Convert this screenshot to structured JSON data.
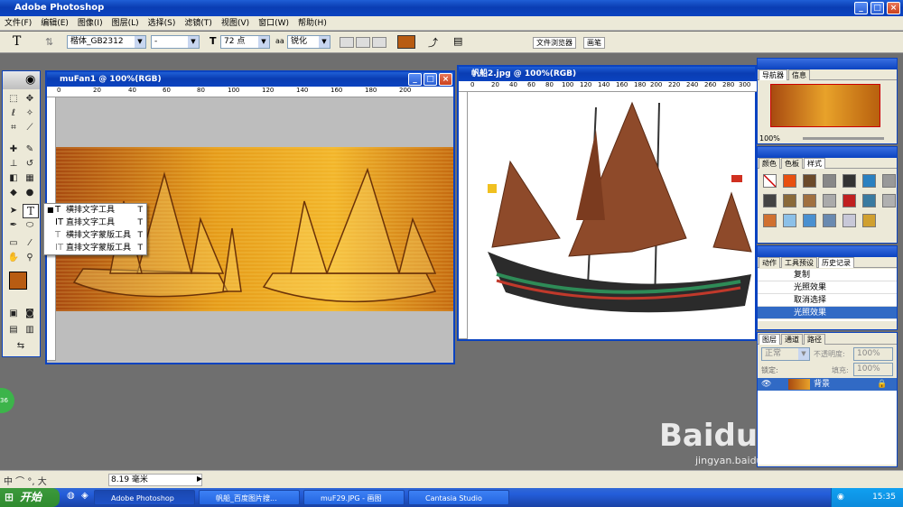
{
  "app": {
    "title": "Adobe Photoshop"
  },
  "menu": [
    "文件(F)",
    "编辑(E)",
    "图像(I)",
    "图层(L)",
    "选择(S)",
    "滤镜(T)",
    "视图(V)",
    "窗口(W)",
    "帮助(H)"
  ],
  "options": {
    "tool_glyph": "T",
    "font_family": "楷体_GB2312",
    "font_style": "-",
    "font_size": "72 点",
    "antialias_prefix": "aa",
    "antialias": "锐化",
    "file_browser_tab": "文件浏览器",
    "brushes_tab": "画笔",
    "text_color": "#b85c12"
  },
  "doc1": {
    "title": "muFan1 @ 100%(RGB)",
    "ruler": [
      "0",
      "20",
      "40",
      "60",
      "80",
      "100",
      "120",
      "140",
      "160",
      "180",
      "200"
    ]
  },
  "doc2": {
    "title": "帆船2.jpg @ 100%(RGB)",
    "ruler": [
      "0",
      "20",
      "40",
      "60",
      "80",
      "100",
      "120",
      "140",
      "160",
      "180",
      "200",
      "220",
      "240",
      "260",
      "280",
      "300"
    ]
  },
  "flyout": [
    {
      "label": "横排文字工具",
      "key": "T",
      "icon": "T"
    },
    {
      "label": "直排文字工具",
      "key": "T",
      "icon": "IT"
    },
    {
      "label": "横排文字蒙版工具",
      "key": "T",
      "icon": "T"
    },
    {
      "label": "直排文字蒙版工具",
      "key": "T",
      "icon": "IT"
    }
  ],
  "navigator": {
    "tabs": [
      "导航器",
      "信息"
    ],
    "zoom": "100%"
  },
  "color": {
    "tabs": [
      "颜色",
      "色板",
      "样式"
    ]
  },
  "history": {
    "tabs": [
      "动作",
      "工具预设",
      "历史记录"
    ],
    "items": [
      "复制",
      "光照效果",
      "取消选择",
      "光照效果"
    ],
    "selected_index": 3
  },
  "layers": {
    "tabs": [
      "图层",
      "通道",
      "路径"
    ],
    "blend": "正常",
    "opacity_label": "不透明度:",
    "opacity": "100%",
    "lock_label": "锁定:",
    "fill_label": "填充:",
    "fill": "100%",
    "layer_name": "背景"
  },
  "status": {
    "zoom_bar": "中 ⌒ °, 大",
    "size": "8.19 毫米",
    "badge": "36"
  },
  "taskbar": {
    "start": "开始",
    "tasks": [
      "Adobe Photoshop",
      "帆船_百度图片搜...",
      "muF29.JPG - 画图",
      "Cantasia Studio"
    ],
    "clock": "15:35"
  },
  "watermark": {
    "brand": "Baidu经验",
    "url": "jingyan.baidu.com"
  }
}
